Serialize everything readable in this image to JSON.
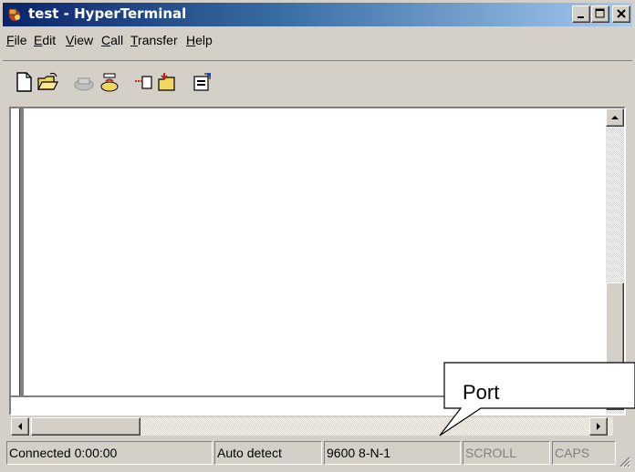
{
  "window": {
    "title": "test - HyperTerminal",
    "controls": [
      "minimize",
      "maximize",
      "close"
    ]
  },
  "menu": {
    "items": [
      {
        "label": "File",
        "mnemonic": "F"
      },
      {
        "label": "Edit",
        "mnemonic": "E"
      },
      {
        "label": "View",
        "mnemonic": "V"
      },
      {
        "label": "Call",
        "mnemonic": "C"
      },
      {
        "label": "Transfer",
        "mnemonic": "T"
      },
      {
        "label": "Help",
        "mnemonic": "H"
      }
    ]
  },
  "toolbar": {
    "buttons": [
      {
        "icon": "new-document-icon"
      },
      {
        "icon": "open-folder-icon"
      },
      {
        "icon": "phone-call-icon",
        "disabled": true
      },
      {
        "icon": "disconnect-icon"
      },
      {
        "icon": "send-file-icon"
      },
      {
        "icon": "receive-file-icon"
      },
      {
        "icon": "properties-icon"
      }
    ]
  },
  "status": {
    "connection": "Connected 0:00:00",
    "detect": "Auto detect",
    "port_settings": "9600 8-N-1",
    "scroll": "SCROLL",
    "caps": "CAPS"
  },
  "annotation": {
    "label": "Port"
  },
  "colors": {
    "titlebar_start": "#0a246a",
    "titlebar_end": "#a6caf0",
    "chrome": "#d4d0c8"
  }
}
